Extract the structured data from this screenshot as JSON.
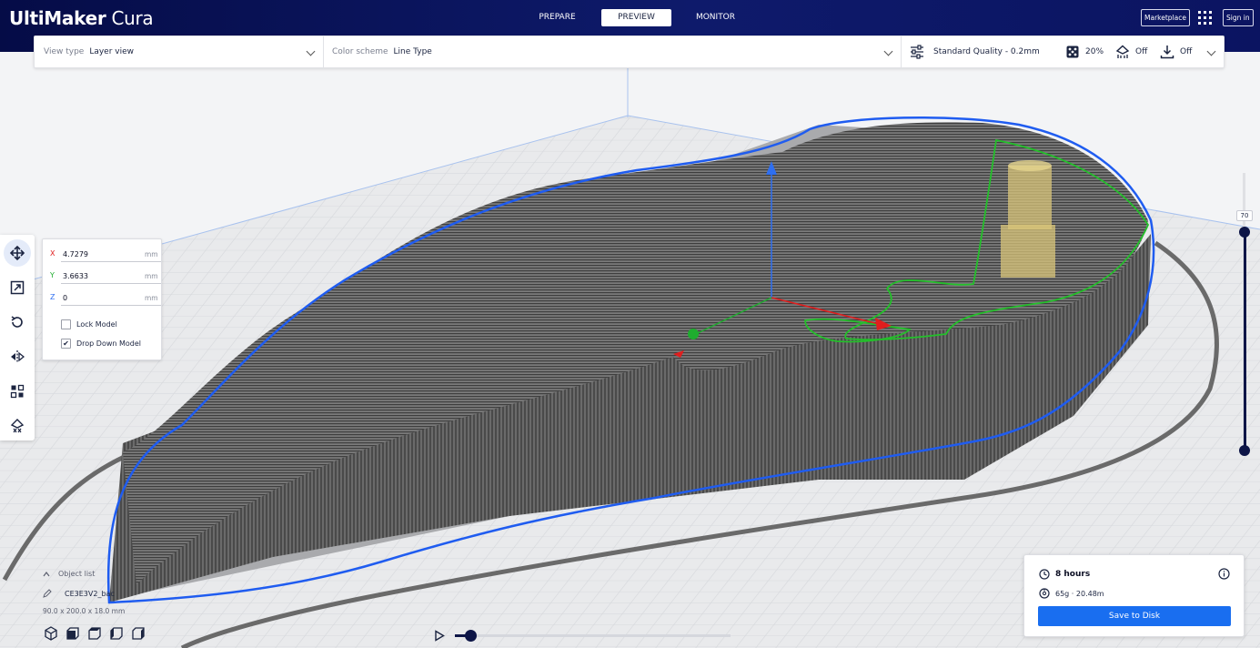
{
  "app": {
    "brand_bold": "UltiMaker",
    "brand_light": " Cura"
  },
  "stages": [
    {
      "label": "PREPARE",
      "active": false
    },
    {
      "label": "PREVIEW",
      "active": true
    },
    {
      "label": "MONITOR",
      "active": false
    }
  ],
  "header": {
    "marketplace_label": "Marketplace",
    "signin_label": "Sign in",
    "apps_icon": "apps-grid-icon"
  },
  "view_settings": {
    "view_type_label": "View type",
    "view_type_value": "Layer view",
    "color_scheme_label": "Color scheme",
    "color_scheme_value": "Line Type"
  },
  "print_setup": {
    "profile": "Standard Quality - 0.2mm",
    "infill": "20%",
    "support": "Off",
    "adhesion": "Off"
  },
  "move_tool": {
    "x_label": "X",
    "x_value": "4.7279",
    "y_label": "Y",
    "y_value": "3.6633",
    "z_label": "Z",
    "z_value": "0",
    "unit": "mm",
    "lock_model_label": "Lock Model",
    "lock_model_checked": false,
    "drop_down_label": "Drop Down Model",
    "drop_down_checked": true,
    "check_mark": "✔"
  },
  "layer_slider": {
    "current_layer": "70"
  },
  "object_list": {
    "header_label": "Object list",
    "item_name": "CE3E3V2_bac",
    "dimensions": "90.0 x 200.0 x 18.0 mm"
  },
  "print_info": {
    "time": "8 hours",
    "material": "65g · 20.48m",
    "save_label": "Save to Disk"
  },
  "colors": {
    "header_bg": "#0e1a6b",
    "accent_blue": "#196ef0",
    "outline_blue": "#1f5cf0",
    "model_gray": "#6f6f6f",
    "axis_x": "#e01e1e",
    "axis_y": "#1fad2f",
    "axis_z": "#2f6ff0"
  }
}
